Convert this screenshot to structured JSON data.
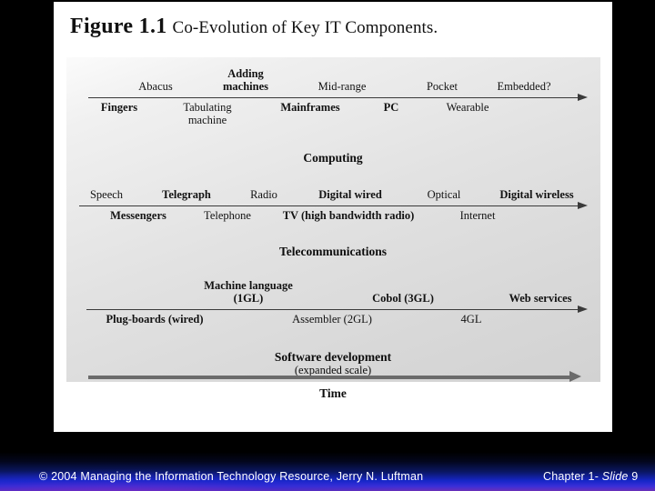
{
  "slide": {
    "figure": {
      "label": "Figure 1.1",
      "title": "Co-Evolution of Key IT Components."
    },
    "diagram": {
      "timelines": [
        {
          "name": "computing",
          "section_title": "Computing",
          "section_subtitle": "",
          "upper_labels": [
            {
              "text": "Abacus",
              "bold": false
            },
            {
              "text": "Adding\nmachines",
              "bold": true
            },
            {
              "text": "Mid-range",
              "bold": false
            },
            {
              "text": "Pocket",
              "bold": false
            },
            {
              "text": "Embedded?",
              "bold": false
            }
          ],
          "lower_labels": [
            {
              "text": "Fingers",
              "bold": true
            },
            {
              "text": "Tabulating\nmachine",
              "bold": false
            },
            {
              "text": "Mainframes",
              "bold": true
            },
            {
              "text": "PC",
              "bold": true
            },
            {
              "text": "Wearable",
              "bold": false
            }
          ]
        },
        {
          "name": "telecommunications",
          "section_title": "Telecommunications",
          "section_subtitle": "",
          "upper_labels": [
            {
              "text": "Speech",
              "bold": false
            },
            {
              "text": "Telegraph",
              "bold": true
            },
            {
              "text": "Radio",
              "bold": false
            },
            {
              "text": "Digital wired",
              "bold": true
            },
            {
              "text": "Optical",
              "bold": false
            },
            {
              "text": "Digital wireless",
              "bold": true
            }
          ],
          "lower_labels": [
            {
              "text": "Messengers",
              "bold": true
            },
            {
              "text": "Telephone",
              "bold": false
            },
            {
              "text": "TV (high bandwidth radio)",
              "bold": true
            },
            {
              "text": "Internet",
              "bold": false
            }
          ]
        },
        {
          "name": "software-development",
          "section_title": "Software development",
          "section_subtitle": "(expanded scale)",
          "upper_labels": [
            {
              "text": "Machine language\n(1GL)",
              "bold": true
            },
            {
              "text": "Cobol (3GL)",
              "bold": true
            },
            {
              "text": "Web services",
              "bold": true
            }
          ],
          "lower_labels": [
            {
              "text": "Plug-boards (wired)",
              "bold": true
            },
            {
              "text": "Assembler (2GL)",
              "bold": false
            },
            {
              "text": "4GL",
              "bold": false
            }
          ]
        }
      ],
      "time_axis_label": "Time"
    }
  },
  "footer": {
    "copyright": "© 2004 Managing the Information Technology Resource,  Jerry N. Luftman",
    "chapter_prefix": "Chapter 1- ",
    "chapter_italic": "Slide",
    "chapter_suffix": " 9"
  },
  "colors": {
    "slide_background": "#000000",
    "page_background": "#ffffff",
    "diagram_background": "#e2e2e2",
    "axis": "#3a3a3a",
    "time_axis": "#6b6b6b",
    "footer_blue": "#1626c8",
    "footer_purple": "#6a2fb8",
    "footer_text": "#ffffff"
  }
}
